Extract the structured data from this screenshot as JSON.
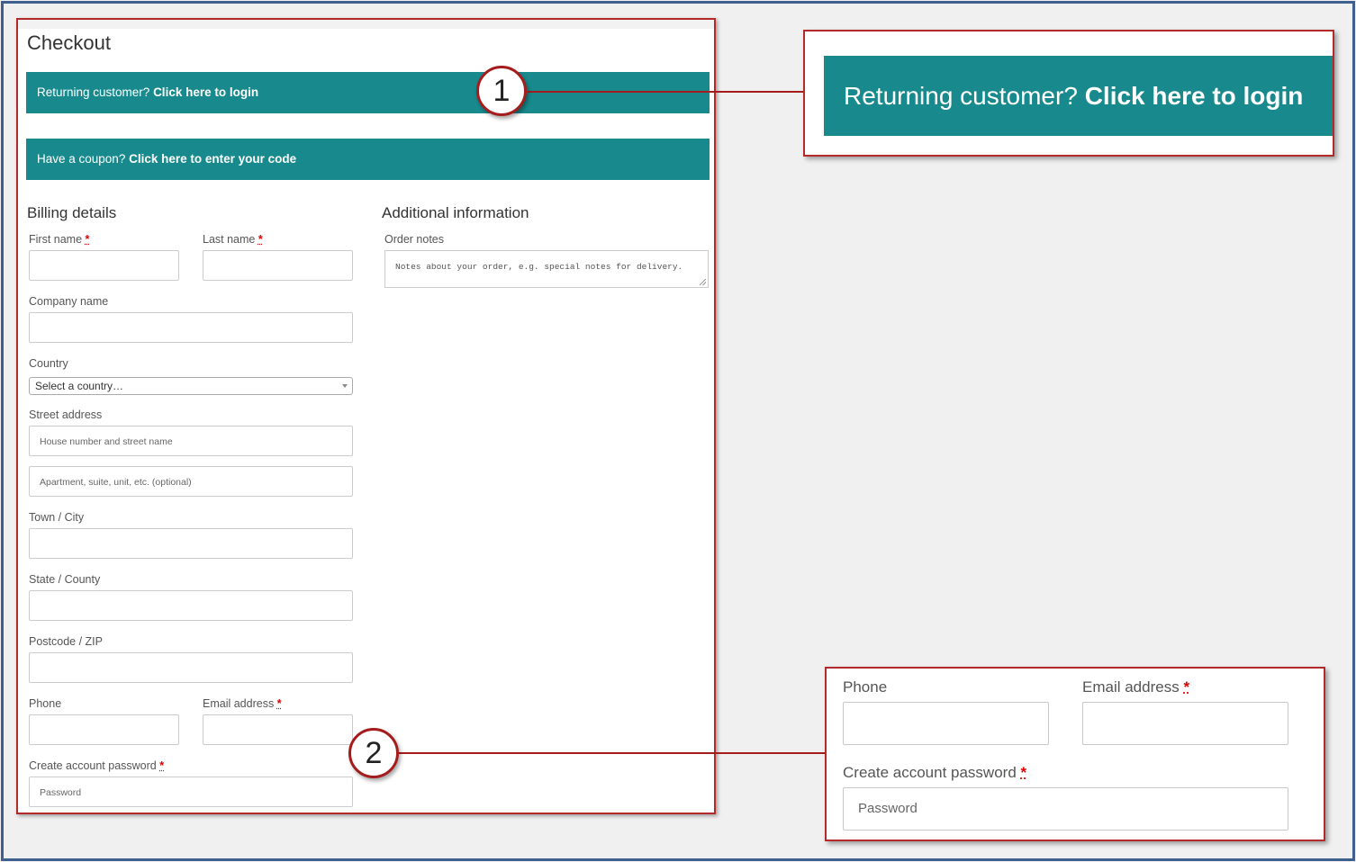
{
  "checkout": {
    "title": "Checkout",
    "returning_notice": {
      "prefix": "Returning customer? ",
      "link": "Click here to login"
    },
    "coupon_notice": {
      "prefix": "Have a coupon? ",
      "link": "Click here to enter your code"
    },
    "billing": {
      "heading": "Billing details",
      "first_name_label": "First name",
      "last_name_label": "Last name",
      "company_label": "Company name",
      "country_label": "Country",
      "country_value": "Select a country…",
      "street_label": "Street address",
      "street_placeholder": "House number and street name",
      "apartment_placeholder": "Apartment, suite, unit, etc. (optional)",
      "town_label": "Town / City",
      "state_label": "State / County",
      "postcode_label": "Postcode / ZIP",
      "phone_label": "Phone",
      "email_label": "Email address",
      "password_label": "Create account password",
      "password_placeholder": "Password",
      "required_marker": "*"
    },
    "additional": {
      "heading": "Additional information",
      "order_notes_label": "Order notes",
      "order_notes_placeholder": "Notes about your order, e.g. special notes for delivery."
    }
  },
  "callouts": {
    "one": "1",
    "two": "2"
  },
  "zoom_login": {
    "prefix": "Returning customer? ",
    "link": "Click here to login"
  },
  "zoom_account": {
    "phone_label": "Phone",
    "email_label": "Email address",
    "password_label": "Create account password",
    "password_placeholder": "Password",
    "required_marker": "*"
  },
  "colors": {
    "notice_teal": "#188a8d",
    "callout_red": "#a51c1c",
    "frame_blue": "#3f5f8f"
  }
}
